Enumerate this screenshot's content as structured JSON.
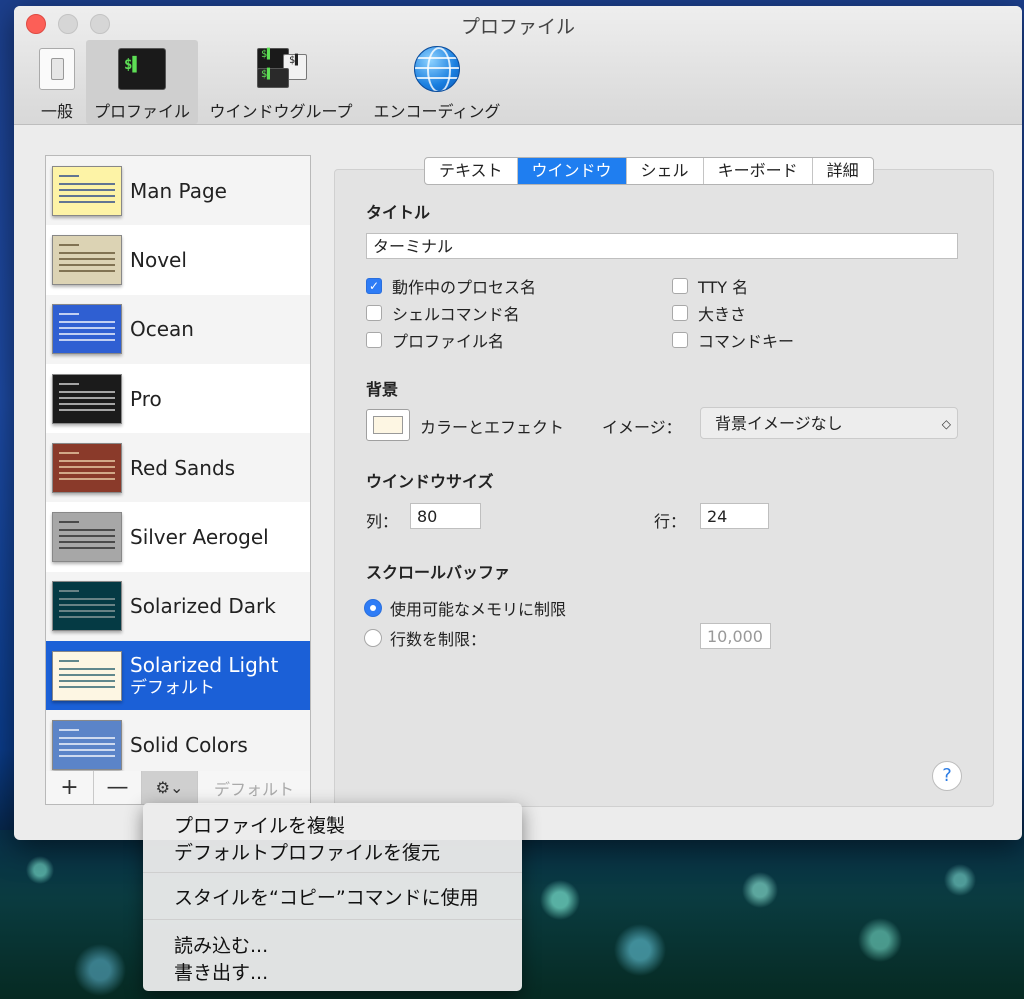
{
  "window": {
    "title": "プロファイル"
  },
  "toolbar": {
    "items": [
      {
        "label": "一般",
        "icon": "switch-icon"
      },
      {
        "label": "プロファイル",
        "icon": "terminal-icon"
      },
      {
        "label": "ウインドウグループ",
        "icon": "window-group-icon"
      },
      {
        "label": "エンコーディング",
        "icon": "globe-icon"
      }
    ],
    "selected": "プロファイル"
  },
  "profiles": [
    {
      "name": "Man Page",
      "thumb_bg": "#fdf3a6",
      "thumb_fg": "#1f3f8a"
    },
    {
      "name": "Novel",
      "thumb_bg": "#dcd3b4",
      "thumb_fg": "#5a4a2a"
    },
    {
      "name": "Ocean",
      "thumb_bg": "#2f5fd2",
      "thumb_fg": "#ffffff"
    },
    {
      "name": "Pro",
      "thumb_bg": "#1b1b1b",
      "thumb_fg": "#e0e0e0"
    },
    {
      "name": "Red Sands",
      "thumb_bg": "#8a3a2a",
      "thumb_fg": "#f1d7b0"
    },
    {
      "name": "Silver Aerogel",
      "thumb_bg": "#a7a7a7",
      "thumb_fg": "#222222"
    },
    {
      "name": "Solarized Dark",
      "thumb_bg": "#053a44",
      "thumb_fg": "#93a1a1"
    },
    {
      "name": "Solarized Light",
      "sub": "デフォルト",
      "thumb_bg": "#fdf6e3",
      "thumb_fg": "#1e5a68"
    },
    {
      "name": "Solid Colors",
      "thumb_bg": "#5b84c8",
      "thumb_fg": "#ffffff"
    }
  ],
  "list_bar": {
    "add": "+",
    "remove": "—",
    "gear": "⚙⌄",
    "default": "デフォルト"
  },
  "tabs": [
    "テキスト",
    "ウインドウ",
    "シェル",
    "キーボード",
    "詳細"
  ],
  "active_tab": "ウインドウ",
  "title_section": {
    "heading": "タイトル",
    "value": "ターミナル",
    "checks": [
      {
        "label": "動作中のプロセス名",
        "checked": true
      },
      {
        "label": "シェルコマンド名",
        "checked": false
      },
      {
        "label": "プロファイル名",
        "checked": false
      },
      {
        "label": "TTY 名",
        "checked": false
      },
      {
        "label": "大きさ",
        "checked": false
      },
      {
        "label": "コマンドキー",
        "checked": false
      }
    ]
  },
  "background": {
    "heading": "背景",
    "color_label": "カラーとエフェクト",
    "image_label": "イメージ：",
    "image_value": "背景イメージなし",
    "swatch_color": "#fdf6e3"
  },
  "window_size": {
    "heading": "ウインドウサイズ",
    "cols_label": "列：",
    "cols": "80",
    "rows_label": "行：",
    "rows": "24"
  },
  "scrollback": {
    "heading": "スクロールバッファ",
    "opt1": "使用可能なメモリに制限",
    "opt2": "行数を制限：",
    "limit": "10,000",
    "selected": 1
  },
  "help": "?",
  "menu": {
    "items": [
      "プロファイルを複製",
      "デフォルトプロファイルを復元",
      "スタイルを“コピー”コマンドに使用",
      "読み込む...",
      "書き出す..."
    ]
  }
}
